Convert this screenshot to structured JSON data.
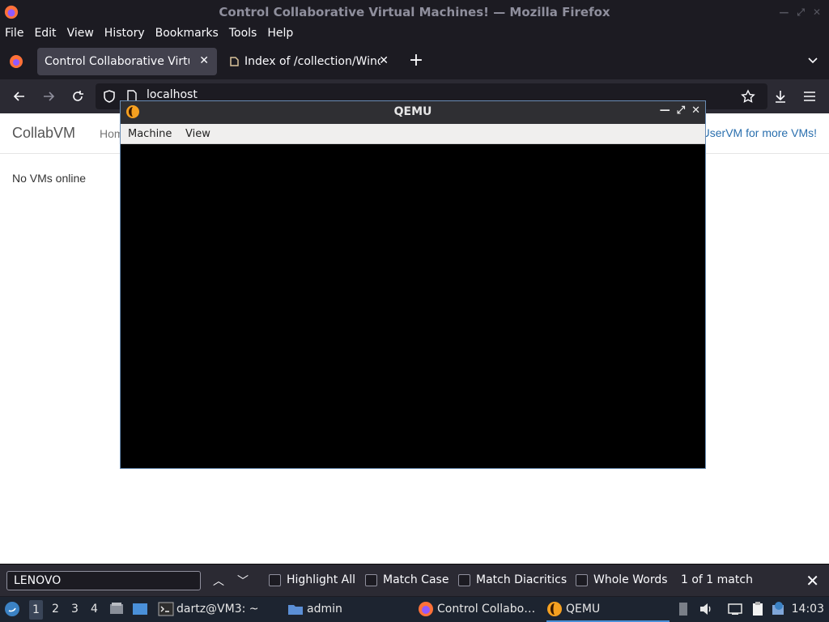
{
  "window": {
    "title": "Control Collaborative Virtual Machines! — Mozilla Firefox"
  },
  "menubar": {
    "file": "File",
    "edit": "Edit",
    "view": "View",
    "history": "History",
    "bookmarks": "Bookmarks",
    "tools": "Tools",
    "help": "Help"
  },
  "tabs": [
    {
      "label": "Control Collaborative Virtual Machines!",
      "active": true
    },
    {
      "label": "Index of /collection/Windows",
      "active": false
    }
  ],
  "urlbar": {
    "url": "localhost"
  },
  "page": {
    "brand": "CollabVM",
    "home_link": "Home",
    "uservm_link": "UserVM for more VMs!",
    "status": "No VMs online"
  },
  "qemu": {
    "title": "QEMU",
    "menu": [
      "Machine",
      "View"
    ]
  },
  "findbar": {
    "query": "LENOVO",
    "highlight_all": "Highlight All",
    "match_case": "Match Case",
    "match_diacritics": "Match Diacritics",
    "whole_words": "Whole Words",
    "result": "1 of 1 match"
  },
  "taskbar": {
    "workspaces": [
      "1",
      "2",
      "3",
      "4"
    ],
    "current_workspace": "1",
    "tasks": [
      {
        "label": "dartz@VM3: ~",
        "icon": "terminal-icon"
      },
      {
        "label": "admin",
        "icon": "folder-icon"
      },
      {
        "label": "Control Collabo…",
        "icon": "firefox-icon"
      },
      {
        "label": "QEMU",
        "icon": "qemu-icon"
      }
    ],
    "clock": "14:03"
  }
}
